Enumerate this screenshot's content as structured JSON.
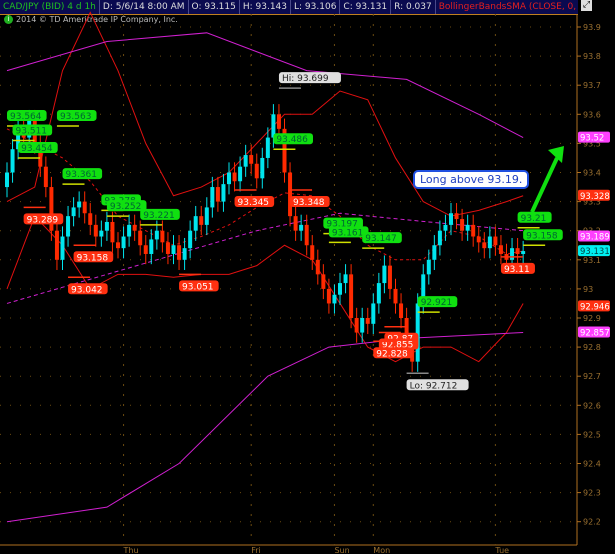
{
  "header": {
    "symbol": "CAD/JPY (BID) 4 d 1h",
    "date": "D: 5/6/14 8:00 AM",
    "open": "O: 93.115",
    "high": "H: 93.143",
    "low": "L: 93.106",
    "close": "C: 93.131",
    "range": "R: 0.037",
    "study": "BollingerBandsSMA (CLOSE, 0, 25, -2.0, ..."
  },
  "copyright": "2014 © TD Ameritrade IP Company, Inc.",
  "note": "Long above 93.19.",
  "colors": {
    "up": "#00e5ee",
    "down": "#ff2a00",
    "band": "#e01010",
    "sma": "#d020d0",
    "green_label": "#10e010",
    "red_label": "#ff3010"
  },
  "chart_data": {
    "type": "candlestick",
    "y_ticks": [
      "93.9",
      "93.8",
      "93.7",
      "93.6",
      "93.5",
      "93.4",
      "93.3",
      "93.2",
      "93.1",
      "93",
      "92.9",
      "92.8",
      "92.7",
      "92.6",
      "92.5",
      "92.4",
      "92.3",
      "92.2"
    ],
    "x_ticks": [
      {
        "label": "Thu",
        "bar": 21
      },
      {
        "label": "Fri",
        "bar": 44
      },
      {
        "label": "Sun",
        "bar": 59
      },
      {
        "label": "Mon",
        "bar": 66
      },
      {
        "label": "Tue",
        "bar": 88
      }
    ],
    "ylim": [
      92.15,
      93.95
    ],
    "closes": [
      93.4,
      93.48,
      93.55,
      93.52,
      93.58,
      93.5,
      93.42,
      93.35,
      93.2,
      93.1,
      93.18,
      93.25,
      93.28,
      93.3,
      93.26,
      93.22,
      93.18,
      93.2,
      93.23,
      93.16,
      93.14,
      93.18,
      93.22,
      93.2,
      93.15,
      93.12,
      93.17,
      93.2,
      93.16,
      93.12,
      93.15,
      93.1,
      93.14,
      93.2,
      93.25,
      93.22,
      93.28,
      93.35,
      93.3,
      93.36,
      93.4,
      93.37,
      93.42,
      93.46,
      93.43,
      93.38,
      93.45,
      93.52,
      93.6,
      93.55,
      93.4,
      93.25,
      93.2,
      93.22,
      93.15,
      93.1,
      93.05,
      93.0,
      92.95,
      92.98,
      93.02,
      93.05,
      92.9,
      92.85,
      92.9,
      92.88,
      92.95,
      93.02,
      93.08,
      93.0,
      92.95,
      92.9,
      92.8,
      92.75,
      92.95,
      93.05,
      93.1,
      93.15,
      93.2,
      93.22,
      93.26,
      93.24,
      93.2,
      93.22,
      93.18,
      93.16,
      93.14,
      93.18,
      93.15,
      93.12,
      93.1,
      93.14,
      93.12,
      93.13
    ],
    "bands": {
      "upper": [
        [
          0,
          93.3
        ],
        [
          5,
          93.35
        ],
        [
          10,
          93.75
        ],
        [
          15,
          93.95
        ],
        [
          20,
          93.75
        ],
        [
          25,
          93.5
        ],
        [
          30,
          93.32
        ],
        [
          35,
          93.35
        ],
        [
          40,
          93.4
        ],
        [
          45,
          93.5
        ],
        [
          50,
          93.6
        ],
        [
          55,
          93.6
        ],
        [
          60,
          93.68
        ],
        [
          65,
          93.65
        ],
        [
          70,
          93.45
        ],
        [
          75,
          93.3
        ],
        [
          80,
          93.25
        ],
        [
          85,
          93.27
        ],
        [
          90,
          93.3
        ],
        [
          93,
          93.32
        ]
      ],
      "mid": [
        [
          0,
          93.55
        ],
        [
          5,
          93.5
        ],
        [
          10,
          93.45
        ],
        [
          15,
          93.37
        ],
        [
          20,
          93.25
        ],
        [
          25,
          93.2
        ],
        [
          30,
          93.15
        ],
        [
          35,
          93.18
        ],
        [
          40,
          93.22
        ],
        [
          45,
          93.28
        ],
        [
          50,
          93.33
        ],
        [
          55,
          93.32
        ],
        [
          60,
          93.25
        ],
        [
          65,
          93.15
        ],
        [
          70,
          93.1
        ],
        [
          75,
          93.1
        ],
        [
          80,
          93.2
        ],
        [
          85,
          93.18
        ],
        [
          90,
          93.12
        ],
        [
          93,
          93.13
        ]
      ],
      "lower": [
        [
          0,
          93.0
        ],
        [
          5,
          93.25
        ],
        [
          10,
          93.15
        ],
        [
          15,
          93.0
        ],
        [
          20,
          93.05
        ],
        [
          25,
          93.05
        ],
        [
          30,
          93.04
        ],
        [
          35,
          93.05
        ],
        [
          40,
          93.05
        ],
        [
          45,
          93.08
        ],
        [
          50,
          93.15
        ],
        [
          55,
          93.1
        ],
        [
          60,
          92.95
        ],
        [
          65,
          92.8
        ],
        [
          70,
          92.75
        ],
        [
          75,
          92.8
        ],
        [
          80,
          92.8
        ],
        [
          85,
          92.75
        ],
        [
          90,
          92.85
        ],
        [
          93,
          92.95
        ]
      ],
      "sma_upper": [
        [
          0,
          93.75
        ],
        [
          18,
          93.85
        ],
        [
          36,
          93.88
        ],
        [
          54,
          93.75
        ],
        [
          72,
          93.72
        ],
        [
          85,
          93.6
        ],
        [
          93,
          93.52
        ]
      ],
      "sma_mid": [
        [
          0,
          92.95
        ],
        [
          27,
          93.1
        ],
        [
          45,
          93.2
        ],
        [
          60,
          93.26
        ],
        [
          76,
          93.23
        ],
        [
          93,
          93.2
        ]
      ],
      "sma_lower": [
        [
          0,
          92.2
        ],
        [
          18,
          92.25
        ],
        [
          31,
          92.4
        ],
        [
          47,
          92.7
        ],
        [
          58,
          92.8
        ],
        [
          72,
          92.83
        ],
        [
          93,
          92.85
        ]
      ]
    },
    "price_labels": [
      {
        "text": "93.564",
        "bar": 0,
        "price": 93.56,
        "kind": "green"
      },
      {
        "text": "93.563",
        "bar": 9,
        "price": 93.56,
        "kind": "green"
      },
      {
        "text": "93.511",
        "bar": 1,
        "price": 93.51,
        "kind": "green"
      },
      {
        "text": "93.454",
        "bar": 2,
        "price": 93.45,
        "kind": "green"
      },
      {
        "text": "93.361",
        "bar": 10,
        "price": 93.36,
        "kind": "green"
      },
      {
        "text": "93.278",
        "bar": 17,
        "price": 93.27,
        "kind": "green"
      },
      {
        "text": "93.252",
        "bar": 18,
        "price": 93.25,
        "kind": "green"
      },
      {
        "text": "93.221",
        "bar": 24,
        "price": 93.22,
        "kind": "green"
      },
      {
        "text": "93.486",
        "bar": 48,
        "price": 93.48,
        "kind": "green"
      },
      {
        "text": "93.197",
        "bar": 57,
        "price": 93.19,
        "kind": "green"
      },
      {
        "text": "93.161",
        "bar": 58,
        "price": 93.16,
        "kind": "green"
      },
      {
        "text": "93.147",
        "bar": 64,
        "price": 93.14,
        "kind": "green"
      },
      {
        "text": "92.921",
        "bar": 74,
        "price": 92.92,
        "kind": "green"
      },
      {
        "text": "93.21",
        "bar": 92,
        "price": 93.21,
        "kind": "green"
      },
      {
        "text": "93.158",
        "bar": 93,
        "price": 93.15,
        "kind": "green"
      },
      {
        "text": "93.289",
        "bar": 3,
        "price": 93.28,
        "kind": "red"
      },
      {
        "text": "93.158",
        "bar": 12,
        "price": 93.15,
        "kind": "red"
      },
      {
        "text": "93.042",
        "bar": 11,
        "price": 93.04,
        "kind": "red"
      },
      {
        "text": "93.051",
        "bar": 31,
        "price": 93.05,
        "kind": "red"
      },
      {
        "text": "93.345",
        "bar": 41,
        "price": 93.34,
        "kind": "red"
      },
      {
        "text": "93.348",
        "bar": 51,
        "price": 93.34,
        "kind": "red"
      },
      {
        "text": "92.87",
        "bar": 68,
        "price": 92.87,
        "kind": "red"
      },
      {
        "text": "92.855",
        "bar": 67,
        "price": 92.85,
        "kind": "red"
      },
      {
        "text": "92.828",
        "bar": 66,
        "price": 92.82,
        "kind": "red"
      },
      {
        "text": "93.11",
        "bar": 89,
        "price": 93.11,
        "kind": "red"
      },
      {
        "text": "Hi: 93.699",
        "bar": 49,
        "price": 93.69,
        "kind": "grey"
      },
      {
        "text": "Lo: 92.712",
        "bar": 72,
        "price": 92.71,
        "kind": "grey"
      }
    ],
    "axis_badges": [
      {
        "text": "93.52",
        "price": 93.52,
        "color": "#ff40ff"
      },
      {
        "text": "93.328",
        "price": 93.32,
        "color": "#ff3010"
      },
      {
        "text": "93.189",
        "price": 93.18,
        "color": "#ff40ff"
      },
      {
        "text": "93.131",
        "price": 93.13,
        "color": "#00f0f0"
      },
      {
        "text": "92.946",
        "price": 92.94,
        "color": "#ff3010"
      },
      {
        "text": "92.857",
        "price": 92.85,
        "color": "#ff40ff"
      }
    ]
  }
}
